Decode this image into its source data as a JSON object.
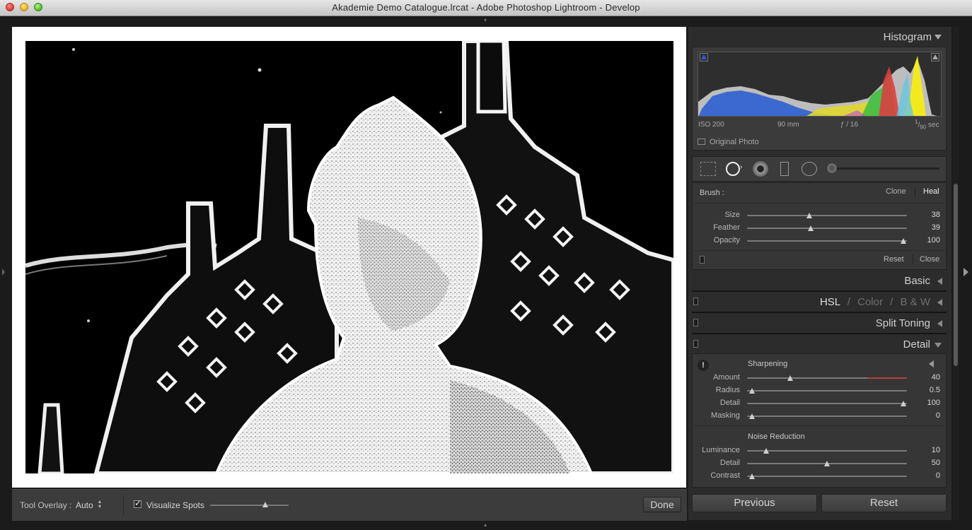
{
  "window": {
    "title": "Akademie Demo Catalogue.lrcat - Adobe Photoshop Lightroom - Develop"
  },
  "toolbar": {
    "tool_overlay_label": "Tool Overlay :",
    "tool_overlay_value": "Auto",
    "visualize_spots_label": "Visualize Spots",
    "visualize_spots_checked": true,
    "visualize_threshold": 0.7,
    "done_label": "Done"
  },
  "histogram": {
    "header": "Histogram",
    "iso": "ISO 200",
    "focal": "90 mm",
    "aperture": "ƒ / 16",
    "shutter_num": "1",
    "shutter_den": "90",
    "shutter_unit": "sec",
    "original_photo_label": "Original Photo"
  },
  "spot_tool": {
    "brush_label": "Brush :",
    "clone_label": "Clone",
    "heal_label": "Heal",
    "sliders": [
      {
        "label": "Size",
        "value": "38",
        "pos": 0.39
      },
      {
        "label": "Feather",
        "value": "39",
        "pos": 0.4
      },
      {
        "label": "Opacity",
        "value": "100",
        "pos": 0.98
      }
    ],
    "reset_label": "Reset",
    "close_label": "Close"
  },
  "panels": {
    "basic": "Basic",
    "hsl": "HSL",
    "color": "Color",
    "bw": "B & W",
    "slash": "/",
    "split_toning": "Split Toning",
    "detail": "Detail"
  },
  "detail": {
    "sharpening_header": "Sharpening",
    "sharpening": [
      {
        "label": "Amount",
        "value": "40",
        "pos": 0.27
      },
      {
        "label": "Radius",
        "value": "0.5",
        "pos": 0.03
      },
      {
        "label": "Detail",
        "value": "100",
        "pos": 0.98
      },
      {
        "label": "Masking",
        "value": "0",
        "pos": 0.03
      }
    ],
    "noise_header": "Noise Reduction",
    "noise": [
      {
        "label": "Luminance",
        "value": "10",
        "pos": 0.12
      },
      {
        "label": "Detail",
        "value": "50",
        "pos": 0.5
      },
      {
        "label": "Contrast",
        "value": "0",
        "pos": 0.03
      }
    ]
  },
  "bottom_buttons": {
    "previous": "Previous",
    "reset": "Reset"
  },
  "colors": {
    "panel_bg": "#2c2c2c",
    "photo_frame": "#ffffff",
    "accent_red": "#b84040"
  }
}
